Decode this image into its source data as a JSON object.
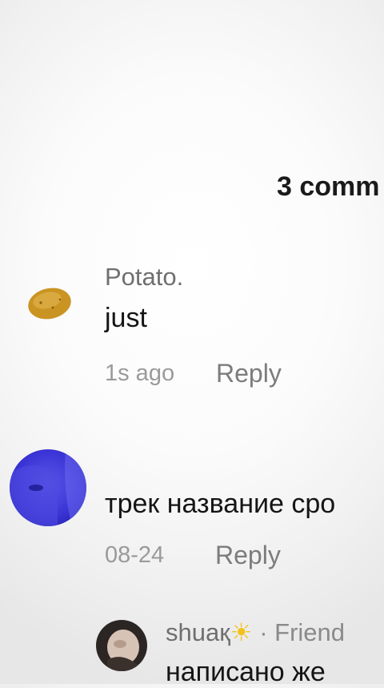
{
  "header": {
    "comment_count": "3 comm"
  },
  "comments": [
    {
      "username": "Potato.",
      "text": "just",
      "time": "1s ago",
      "reply_label": "Reply",
      "avatar_icon": "potato-icon"
    },
    {
      "username": "",
      "text": "трек название сро",
      "time": "08-24",
      "reply_label": "Reply",
      "avatar_icon": "profile-photo"
    }
  ],
  "reply_thread": {
    "username": "shuaқ",
    "emoji": "☀",
    "separator": " · ",
    "tag": "Friend",
    "text": "написано же"
  },
  "colors": {
    "text_primary": "#151515",
    "text_muted": "#9a9a9a",
    "username": "#6f6f6f"
  }
}
